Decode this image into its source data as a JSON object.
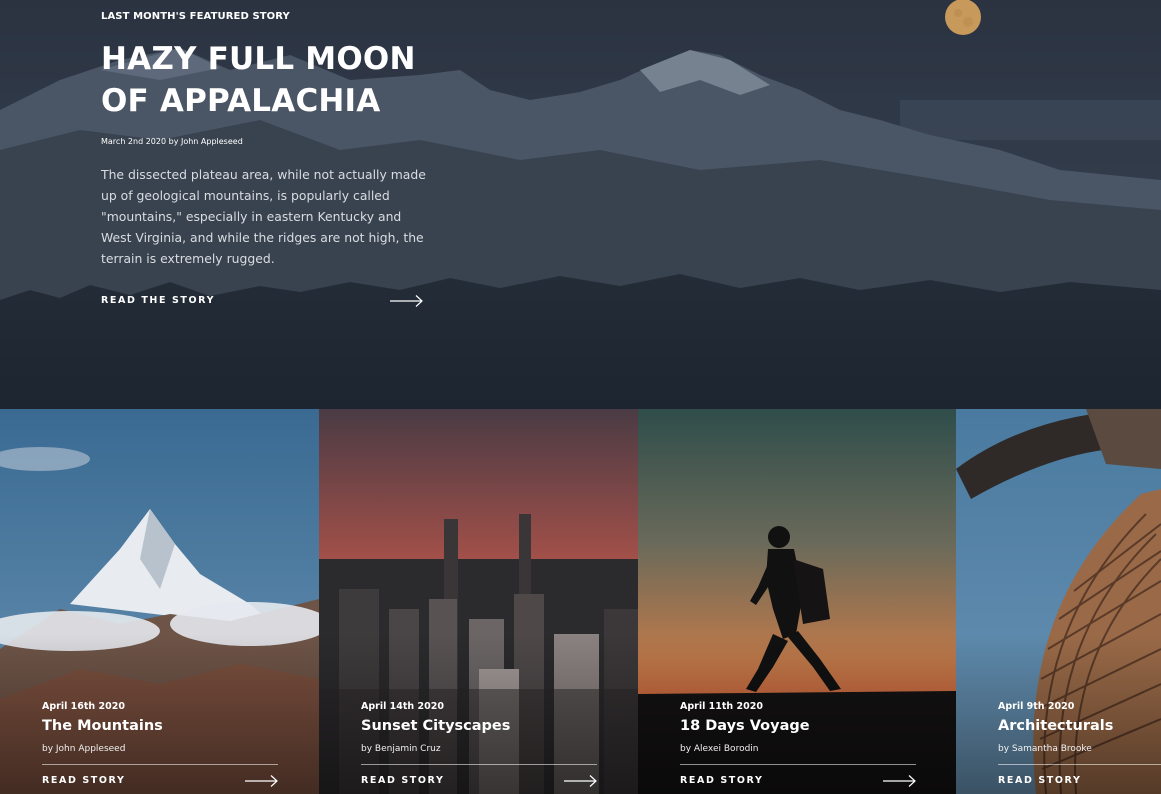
{
  "featured": {
    "eyebrow": "LAST MONTH'S FEATURED STORY",
    "title": "HAZY FULL MOON OF APPALACHIA",
    "byline": "March 2nd 2020 by John Appleseed",
    "excerpt": "The dissected plateau area, while not actually made up of geological mountains, is popularly called \"mountains,\" especially in eastern Kentucky and West Virginia, and while the ridges are not high, the terrain is extremely rugged.",
    "read_label": "READ THE STORY",
    "arrow_icon": "arrow-right-icon"
  },
  "cards": [
    {
      "date": "April 16th 2020",
      "title": "The Mountains",
      "author": "by John Appleseed",
      "read_label": "READ STORY",
      "arrow_icon": "arrow-right-icon"
    },
    {
      "date": "April 14th 2020",
      "title": "Sunset Cityscapes",
      "author": "by Benjamin Cruz",
      "read_label": "READ STORY",
      "arrow_icon": "arrow-right-icon"
    },
    {
      "date": "April 11th 2020",
      "title": "18 Days Voyage",
      "author": "by Alexei Borodin",
      "read_label": "READ STORY",
      "arrow_icon": "arrow-right-icon"
    },
    {
      "date": "April 9th 2020",
      "title": "Architecturals",
      "author": "by Samantha Brooke",
      "read_label": "READ STORY",
      "arrow_icon": "arrow-right-icon"
    }
  ],
  "colors": {
    "hero_overlay": "#2a3341",
    "text": "#ffffff",
    "moon": "#c79a5b"
  }
}
